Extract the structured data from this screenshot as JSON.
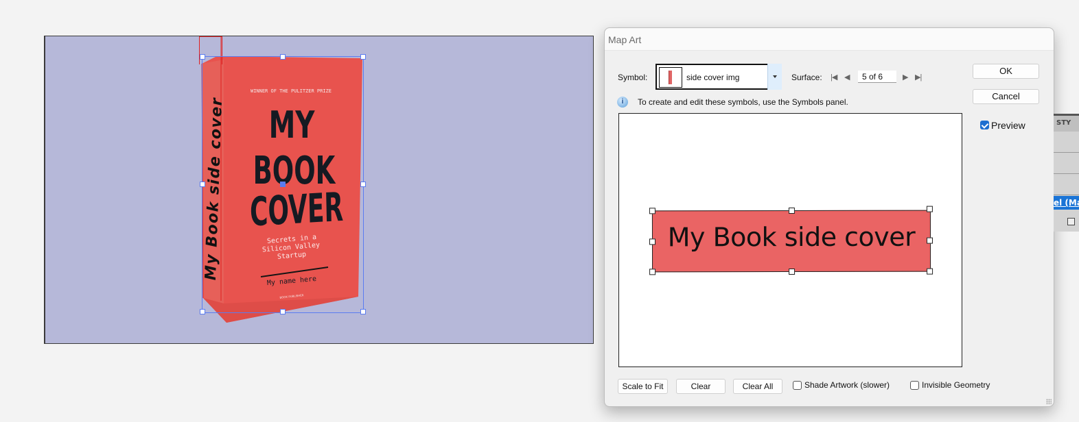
{
  "artboard": {
    "background": "#b6b8d9",
    "book": {
      "color": "#e8534e",
      "spine_text": "My Book side cover",
      "front": {
        "award": "WINNER OF THE PULITZER PRIZE",
        "title_lines": [
          "MY",
          "BOOK",
          "COVER"
        ],
        "subtitle_lines": [
          "Secrets in a",
          "Silicon Valley",
          "Startup"
        ],
        "author": "My name here",
        "publisher": "BOOK PUBLISHER"
      }
    }
  },
  "dialog": {
    "title": "Map Art",
    "symbol_label": "Symbol:",
    "symbol_value": "side cover img",
    "surface_label": "Surface:",
    "surface_value": "5 of 6",
    "nav": {
      "first": "|◀",
      "prev": "◀",
      "next": "▶",
      "last": "▶|"
    },
    "info_text": "To create and edit these symbols, use the Symbols panel.",
    "preview_art_text": "My Book side cover",
    "preview_art_color": "#ea6464",
    "buttons": {
      "ok": "OK",
      "cancel": "Cancel",
      "scale_to_fit": "Scale to Fit",
      "clear": "Clear",
      "clear_all": "Clear All"
    },
    "checkboxes": {
      "preview": {
        "label": "Preview",
        "checked": true
      },
      "shade_artwork": {
        "label": "Shade Artwork (slower)",
        "checked": false
      },
      "invisible_geometry": {
        "label": "Invisible Geometry",
        "checked": false
      }
    }
  },
  "side_panel": {
    "tab_label": "STY",
    "selected_item": "el (Ma"
  }
}
